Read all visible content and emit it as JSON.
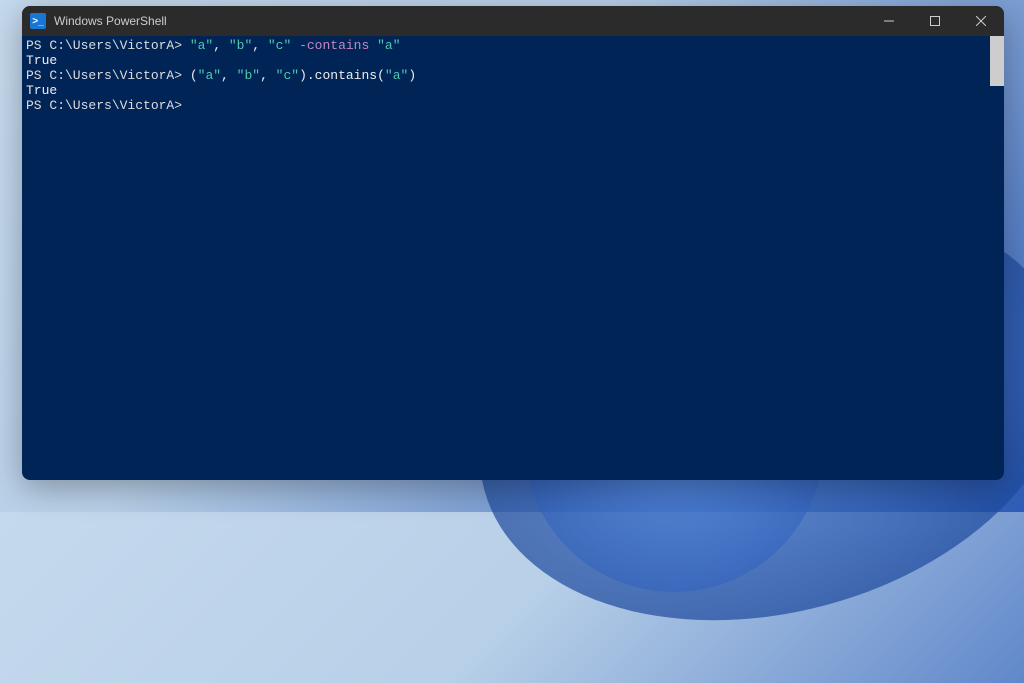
{
  "window": {
    "title": "Windows PowerShell"
  },
  "terminal": {
    "lines": [
      {
        "prompt": "PS C:\\Users\\VictorA> ",
        "cmd_parts": [
          "\"a\"",
          ", ",
          "\"b\"",
          ", ",
          "\"c\"",
          " ",
          "-contains",
          " ",
          "\"a\""
        ]
      },
      {
        "output": "True"
      },
      {
        "prompt": "PS C:\\Users\\VictorA> ",
        "cmd_parts": [
          "(",
          "\"a\"",
          ", ",
          "\"b\"",
          ", ",
          "\"c\"",
          ").contains(",
          "\"a\"",
          ")"
        ]
      },
      {
        "output": "True"
      },
      {
        "prompt": "PS C:\\Users\\VictorA>",
        "cmd_parts": []
      }
    ]
  }
}
